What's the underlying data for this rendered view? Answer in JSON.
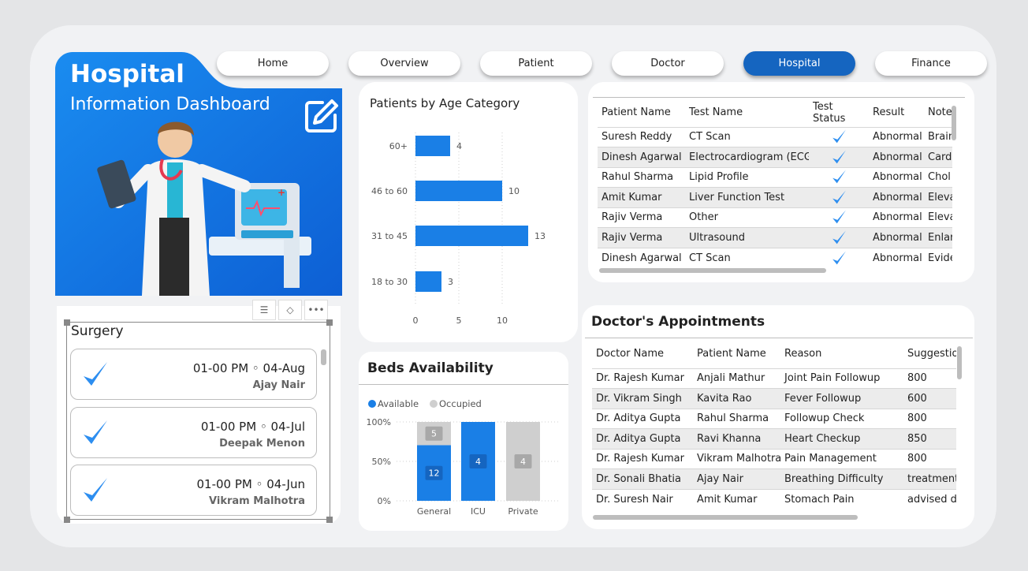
{
  "nav": [
    {
      "label": "Home",
      "active": false
    },
    {
      "label": "Overview",
      "active": false
    },
    {
      "label": "Patient",
      "active": false
    },
    {
      "label": "Doctor",
      "active": false
    },
    {
      "label": "Hospital",
      "active": true
    },
    {
      "label": "Finance",
      "active": false
    }
  ],
  "hero": {
    "title": "Hospital",
    "subtitle": "Information Dashboard"
  },
  "surgery": {
    "title": "Surgery",
    "items": [
      {
        "when": "01-00 PM ◦ 04-Aug",
        "who": "Ajay Nair"
      },
      {
        "when": "01-00 PM ◦ 04-Jul",
        "who": "Deepak Menon"
      },
      {
        "when": "01-00 PM ◦ 04-Jun",
        "who": "Vikram Malhotra"
      }
    ]
  },
  "age_chart": {
    "title": "Patients by Age Category"
  },
  "beds": {
    "title": "Beds Availability",
    "legend": [
      {
        "label": "Available",
        "color": "#1a7fe6"
      },
      {
        "label": "Occupied",
        "color": "#cfcfcf"
      }
    ]
  },
  "chart_data": [
    {
      "type": "bar",
      "orientation": "horizontal",
      "title": "Patients by Age Category",
      "categories": [
        "60+",
        "46 to 60",
        "31 to 45",
        "18 to 30"
      ],
      "values": [
        4,
        10,
        13,
        3
      ],
      "xticks": [
        "0",
        "5",
        "10"
      ],
      "xlim": [
        0,
        15
      ],
      "grid": "vertical-dotted",
      "color": "#1a7fe6"
    },
    {
      "type": "bar",
      "stacked": "percent",
      "title": "Beds Availability",
      "categories": [
        "General",
        "ICU",
        "Private"
      ],
      "series": [
        {
          "name": "Available",
          "values": [
            12,
            4,
            0
          ],
          "color": "#1a7fe6"
        },
        {
          "name": "Occupied",
          "values": [
            5,
            0,
            4
          ],
          "color": "#cfcfcf"
        }
      ],
      "yticks": [
        "100%",
        "50%",
        "0%"
      ],
      "legend": "top-left"
    }
  ],
  "tests_table": {
    "columns": [
      "Patient Name",
      "Test Name",
      "Test Status",
      "Result",
      "Notes"
    ],
    "rows": [
      [
        "Suresh Reddy",
        "CT Scan",
        "✓",
        "Abnormal",
        "Brain"
      ],
      [
        "Dinesh Agarwal",
        "Electrocardiogram (ECG)",
        "✓",
        "Abnormal",
        "Card"
      ],
      [
        "Rahul Sharma",
        "Lipid Profile",
        "✓",
        "Abnormal",
        "Chol"
      ],
      [
        "Amit Kumar",
        "Liver Function Test",
        "✓",
        "Abnormal",
        "Eleva"
      ],
      [
        "Rajiv Verma",
        "Other",
        "✓",
        "Abnormal",
        "Eleva"
      ],
      [
        "Rajiv Verma",
        "Ultrasound",
        "✓",
        "Abnormal",
        "Enlar"
      ],
      [
        "Dinesh Agarwal",
        "CT Scan",
        "✓",
        "Abnormal",
        "Evide"
      ]
    ]
  },
  "appointments": {
    "title": "Doctor's Appointments",
    "columns": [
      "Doctor Name",
      "Patient Name",
      "Reason",
      "Suggestion"
    ],
    "rows": [
      [
        "Dr. Rajesh Kumar",
        "Anjali Mathur",
        "Joint Pain Followup",
        "800"
      ],
      [
        "Dr. Vikram Singh",
        "Kavita Rao",
        "Fever Followup",
        "600"
      ],
      [
        "Dr. Aditya Gupta",
        "Rahul Sharma",
        "Followup Check",
        "800"
      ],
      [
        "Dr. Aditya Gupta",
        "Ravi Khanna",
        "Heart Checkup",
        "850"
      ],
      [
        "Dr. Rajesh Kumar",
        "Vikram Malhotra",
        "Pain Management",
        "800"
      ],
      [
        "Dr. Sonali Bhatia",
        "Ajay Nair",
        "Breathing Difficulty",
        "treatment"
      ],
      [
        "Dr. Suresh Nair",
        "Amit Kumar",
        "Stomach Pain",
        "advised die"
      ]
    ]
  }
}
